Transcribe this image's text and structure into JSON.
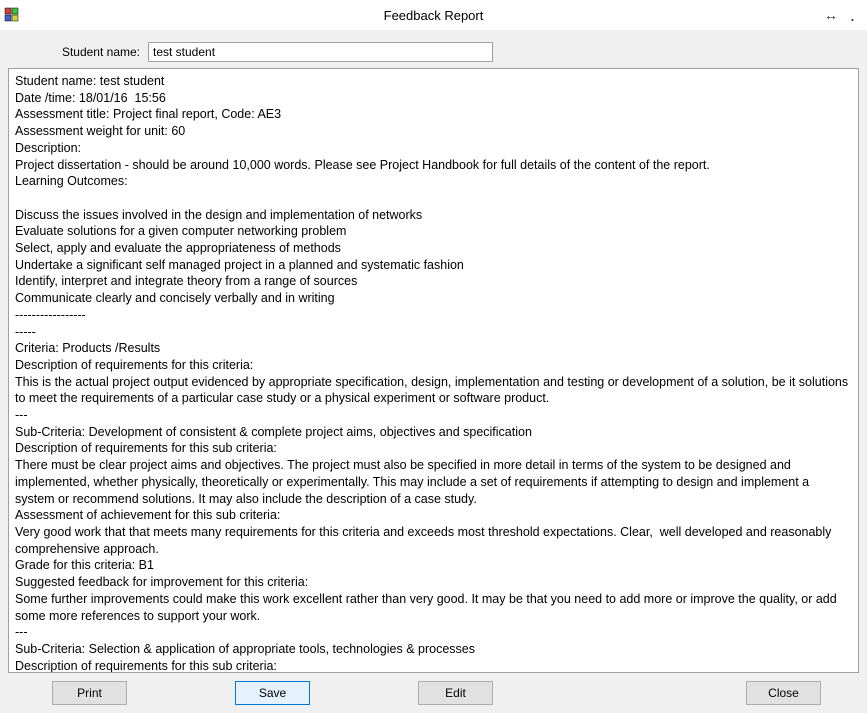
{
  "window": {
    "title": "Feedback Report"
  },
  "form": {
    "student_name_label": "Student name:",
    "student_name_value": "test student"
  },
  "report": {
    "text": "Student name: test student\nDate /time: 18/01/16  15:56\nAssessment title: Project final report, Code: AE3\nAssessment weight for unit: 60\nDescription:\nProject dissertation - should be around 10,000 words. Please see Project Handbook for full details of the content of the report.\nLearning Outcomes:\n\nDiscuss the issues involved in the design and implementation of networks\nEvaluate solutions for a given computer networking problem\nSelect, apply and evaluate the appropriateness of methods\nUndertake a significant self managed project in a planned and systematic fashion\nIdentify, interpret and integrate theory from a range of sources\nCommunicate clearly and concisely verbally and in writing\n-----------------\n-----\nCriteria: Products /Results\nDescription of requirements for this criteria:\nThis is the actual project output evidenced by appropriate specification, design, implementation and testing or development of a solution, be it solutions to meet the requirements of a particular case study or a physical experiment or software product.\n---\nSub-Criteria: Development of consistent & complete project aims, objectives and specification\nDescription of requirements for this sub criteria:\nThere must be clear project aims and objectives. The project must also be specified in more detail in terms of the system to be designed and implemented, whether physically, theoretically or experimentally. This may include a set of requirements if attempting to design and implement a system or recommend solutions. It may also include the description of a case study.\nAssessment of achievement for this sub criteria:\nVery good work that that meets many requirements for this criteria and exceeds most threshold expectations. Clear,  well developed and reasonably comprehensive approach.\nGrade for this criteria: B1\nSuggested feedback for improvement for this criteria:\nSome further improvements could make this work excellent rather than very good. It may be that you need to add more or improve the quality, or add some more references to support your work.\n---\nSub-Criteria: Selection & application of appropriate tools, technologies & processes\nDescription of requirements for this sub criteria:\nThis should include an Options Analysis, which should justify choices made within the project, supported by literature, for example relating to methodology and enabling technologies.\nYou must discuss the candidate solutions that you considered for the project, with the aid of references, analysing the suitability of each for your project and justifying your choice of the chosen options that you used in realising the objectives of your project."
  },
  "buttons": {
    "print": "Print",
    "save": "Save",
    "edit": "Edit",
    "close": "Close"
  }
}
